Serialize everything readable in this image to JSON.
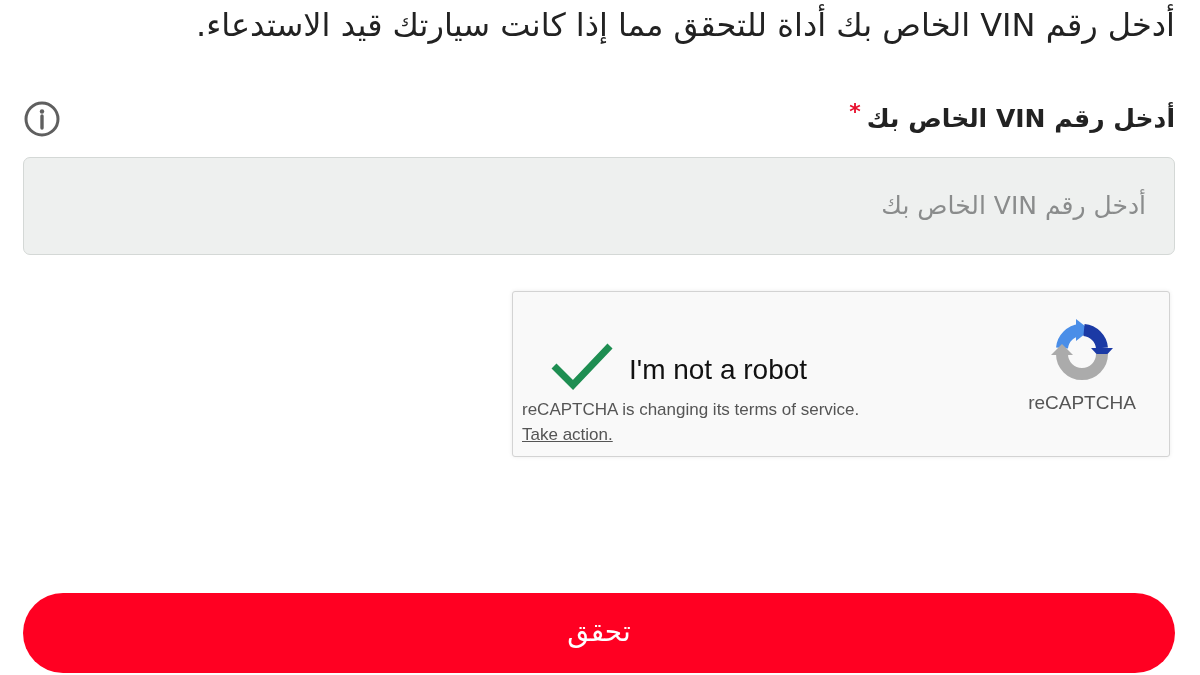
{
  "intro": {
    "text": "أدخل رقم VIN الخاص بك أداة للتحقق مما إذا كانت سيارتك قيد الاستدعاء."
  },
  "vin_field": {
    "label": "أدخل رقم VIN الخاص بك",
    "required_mark": "*",
    "placeholder": "أدخل رقم VIN الخاص بك"
  },
  "captcha": {
    "checked": true,
    "label": "I'm not a robot",
    "notice": "reCAPTCHA is changing its terms of service.",
    "notice_link": "Take action.",
    "brand": "reCAPTCHA"
  },
  "submit_button": {
    "label": "تحقق"
  }
}
